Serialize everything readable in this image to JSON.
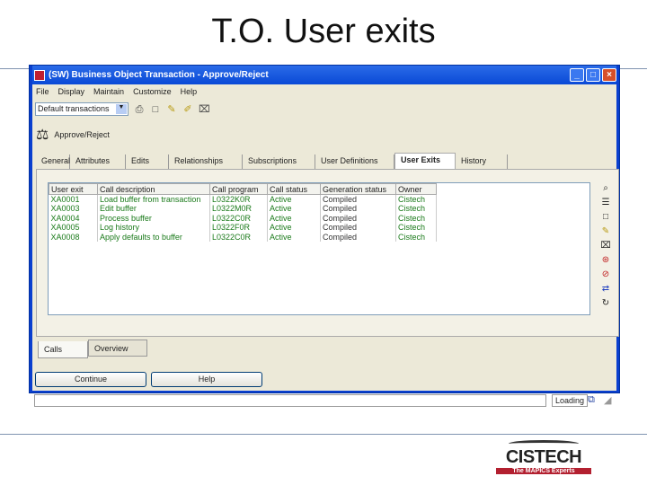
{
  "slide_title": "T.O. User exits",
  "window": {
    "title": "(SW) Business Object Transaction - Approve/Reject"
  },
  "menu": [
    "File",
    "Display",
    "Maintain",
    "Customize",
    "Help"
  ],
  "toolbar": {
    "view_select": "Default transactions"
  },
  "action_label": "Approve/Reject",
  "tabs": [
    "General",
    "Attributes",
    "Edits",
    "Relationships",
    "Subscriptions",
    "User Definitions",
    "User Exits",
    "History"
  ],
  "active_tab": "User Exits",
  "table": {
    "headers": [
      "User exit",
      "Call description",
      "Call program",
      "Call status",
      "Generation status",
      "Owner"
    ],
    "rows": [
      [
        "XA0001",
        "Load buffer from transaction",
        "L0322K0R",
        "Active",
        "Compiled",
        "Cistech"
      ],
      [
        "XA0003",
        "Edit buffer",
        "L0322M0R",
        "Active",
        "Compiled",
        "Cistech"
      ],
      [
        "XA0004",
        "Process buffer",
        "L0322C0R",
        "Active",
        "Compiled",
        "Cistech"
      ],
      [
        "XA0005",
        "Log history",
        "L0322F0R",
        "Active",
        "Compiled",
        "Cistech"
      ],
      [
        "XA0008",
        "Apply defaults to buffer",
        "L0322C0R",
        "Active",
        "Compiled",
        "Cistech"
      ]
    ]
  },
  "bottom_tabs": [
    "Calls",
    "Overview"
  ],
  "buttons": {
    "continue": "Continue",
    "help": "Help"
  },
  "status": {
    "mode": "Loading"
  },
  "logo": {
    "name": "CISTECH",
    "tagline": "The MAPICS Experts"
  }
}
